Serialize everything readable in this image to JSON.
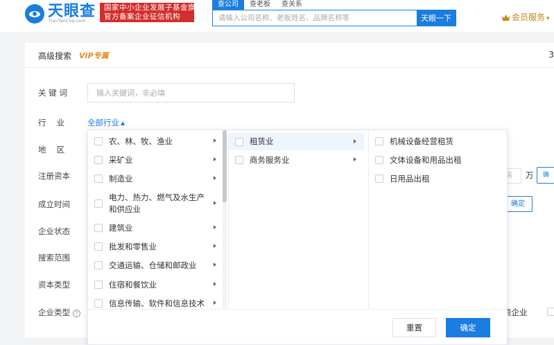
{
  "header": {
    "logo_text": "天眼查",
    "logo_sub": "TianYanCha.com",
    "gov_badge_line1": "国家中小企业发展子基金旗下",
    "gov_badge_line2": "官方备案企业征信机构",
    "search_tabs": [
      {
        "label": "查公司",
        "active": true
      },
      {
        "label": "查老板",
        "active": false
      },
      {
        "label": "查关系",
        "active": false
      }
    ],
    "search_placeholder": "请输入公司名称、老板姓名、品牌名称等",
    "search_button": "天眼一下",
    "vip_label": "会员服务",
    "vip_caret": "▾"
  },
  "panel": {
    "title": "高级搜索",
    "vip_tag": "VIP专属",
    "right_num": "3",
    "labels": {
      "keyword": "关 键 词",
      "industry": "行　 业",
      "region": "地　 区",
      "capital": "注册资本",
      "found_date": "成立时间",
      "status": "企业状态",
      "scope": "搜索范围",
      "capital_type": "资本类型",
      "company_type": "企业类型"
    },
    "keyword_placeholder": "输入关键词，非必填",
    "industry_select": "全部行业",
    "capital_unit_placeholder": "高",
    "capital_unit": "万",
    "capital_confirm": "确",
    "date_confirm": "确定",
    "foreign_label": "资企业",
    "help": "?"
  },
  "dropdown": {
    "col1": [
      {
        "label": "农、林、牧、渔业"
      },
      {
        "label": "采矿业"
      },
      {
        "label": "制造业"
      },
      {
        "label": "电力、热力、燃气及水生产",
        "label2": "和供应业"
      },
      {
        "label": "建筑业"
      },
      {
        "label": "批发和零售业"
      },
      {
        "label": "交通运输、仓储和邮政业"
      },
      {
        "label": "住宿和餐饮业"
      },
      {
        "label": "信息传输、软件和信息技术"
      }
    ],
    "col2": [
      {
        "label": "租赁业"
      },
      {
        "label": "商务服务业"
      }
    ],
    "col3": [
      {
        "label": "机械设备经营租赁"
      },
      {
        "label": "文体设备和用品出租"
      },
      {
        "label": "日用品出租"
      }
    ],
    "reset": "重置",
    "ok": "确定"
  },
  "colors": {
    "brand_blue": "#1a7de0",
    "badge_red": "#d42d2d",
    "vip_gold": "#c5851b",
    "vip_tag_orange": "#e88a2a",
    "highlight_row": "#eef5fe"
  }
}
